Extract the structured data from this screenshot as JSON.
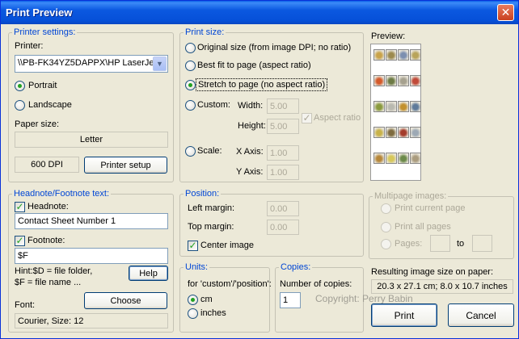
{
  "window": {
    "title": "Print Preview",
    "close_glyph": "✕"
  },
  "printer_settings": {
    "legend": "Printer settings:",
    "printer_label": "Printer:",
    "printer_value": "\\\\PB-FK34YZ5DAPPX\\HP LaserJe",
    "portrait": "Portrait",
    "landscape": "Landscape",
    "paper_size_label": "Paper size:",
    "paper_size_value": "Letter",
    "dpi": "600 DPI",
    "printer_setup_button": "Printer setup"
  },
  "print_size": {
    "legend": "Print size:",
    "original": "Original size (from image DPI; no ratio)",
    "best_fit": "Best fit to page (aspect ratio)",
    "stretch": "Stretch to page (no aspect ratio)",
    "custom": "Custom:",
    "width_label": "Width:",
    "width_value": "5.00",
    "height_label": "Height:",
    "height_value": "5.00",
    "aspect_ratio": "Aspect ratio",
    "scale": "Scale:",
    "xaxis_label": "X Axis:",
    "xaxis_value": "1.00",
    "yaxis_label": "Y Axis:",
    "yaxis_value": "1.00"
  },
  "preview": {
    "label": "Preview:"
  },
  "headnote": {
    "legend": "Headnote/Footnote text:",
    "headnote_label": "Headnote:",
    "headnote_value": "Contact Sheet Number 1",
    "footnote_label": "Footnote:",
    "footnote_value": "$F",
    "hint_line1": "Hint:$D = file folder,",
    "hint_line2": "$F = file name ...",
    "help_button": "Help",
    "font_label": "Font:",
    "choose_button": "Choose",
    "font_value": "Courier, Size: 12"
  },
  "position": {
    "legend": "Position:",
    "left_margin_label": "Left margin:",
    "left_margin_value": "0.00",
    "top_margin_label": "Top margin:",
    "top_margin_value": "0.00",
    "center_image": "Center image"
  },
  "multipage": {
    "legend": "Multipage images:",
    "current": "Print current page",
    "all": "Print all pages",
    "pages": "Pages:",
    "to": "to"
  },
  "units": {
    "legend": "Units:",
    "hint": "for 'custom'/'position':",
    "cm": "cm",
    "inches": "inches"
  },
  "copies": {
    "legend": "Copies:",
    "label": "Number of copies:",
    "value": "1"
  },
  "result": {
    "label": "Resulting image size on paper:",
    "value": "20.3 x 27.1 cm; 8.0 x 10.7 inches"
  },
  "watermark": "Copyright: Perry Babin",
  "buttons": {
    "print": "Print",
    "cancel": "Cancel"
  },
  "thumb_colors": [
    "#C9A34A",
    "#9C8A4E",
    "#7C8FB0",
    "#B8A45A",
    "#D45A2B",
    "#6D7B45",
    "#A6A18F",
    "#C14A3A",
    "#8A9A3E",
    "#B9B9B0",
    "#C2902E",
    "#5E7A9A",
    "#C8B24A",
    "#7E6B3F",
    "#A43C2C",
    "#9DA9B5",
    "#B6873A",
    "#D7C85B",
    "#6C8A4A",
    "#AA9C7E"
  ]
}
